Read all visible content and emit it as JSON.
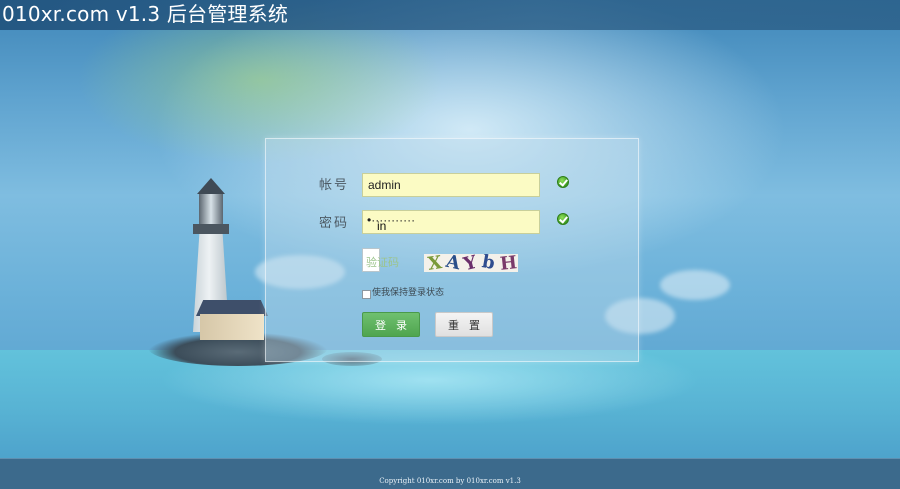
{
  "header": {
    "title": "010xr.com v1.3 后台管理系统"
  },
  "login": {
    "account_label": "帐号",
    "account_value": "admin",
    "password_label": "密码",
    "password_dots": "•···········",
    "password_overlay": "in",
    "captcha_placeholder": "验证码",
    "captcha_chars": [
      "X",
      "A",
      "Y",
      "b",
      "H"
    ],
    "remember_label": "使我保持登录状态",
    "remember_checked": false,
    "login_button": "登录",
    "reset_button": "重置",
    "valid_icon": "check-circle-icon"
  },
  "footer": {
    "copyright": "Copyright 010xr.com by 010xr.com v1.3"
  },
  "colors": {
    "header_bg": "#2d5f87",
    "login_button": "#5cb25c",
    "input_bg": "#fbfbc4",
    "footer_bg": "#3c6a8c"
  }
}
